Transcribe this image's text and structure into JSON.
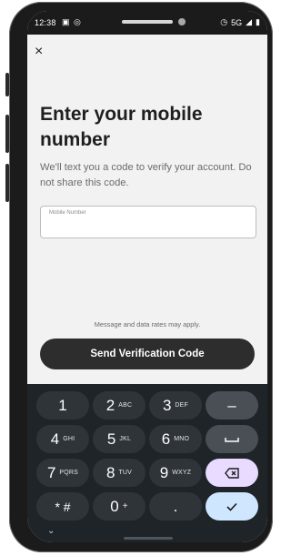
{
  "status_bar": {
    "time": "12:38",
    "network": "5G"
  },
  "page": {
    "title": "Enter your mobile number",
    "subtitle": "We'll text you a code to verify your account. Do not share this code.",
    "input": {
      "label": "Mobile Number",
      "value": ""
    },
    "disclaimer": "Message and data rates may apply.",
    "send_button": "Send Verification Code"
  },
  "keypad": {
    "keys": [
      {
        "num": "1",
        "letters": ""
      },
      {
        "num": "2",
        "letters": "ABC"
      },
      {
        "num": "3",
        "letters": "DEF"
      },
      {
        "num": "4",
        "letters": "GHI"
      },
      {
        "num": "5",
        "letters": "JKL"
      },
      {
        "num": "6",
        "letters": "MNO"
      },
      {
        "num": "7",
        "letters": "PQRS"
      },
      {
        "num": "8",
        "letters": "TUV"
      },
      {
        "num": "9",
        "letters": "WXYZ"
      },
      {
        "num": "* #",
        "letters": ""
      },
      {
        "num": "0",
        "letters": "+"
      },
      {
        "num": ".",
        "letters": ""
      }
    ],
    "functions": {
      "minus": "–"
    }
  },
  "colors": {
    "keypad_bg": "#1f2428",
    "key_bg": "#2f3439",
    "fn_key_bg": "#4a4f55",
    "delete_key_bg": "#e9dbff",
    "confirm_key_bg": "#cfe6ff",
    "button_bg": "#2d2d2d"
  },
  "icons": {
    "close": "close-icon",
    "delete": "backspace-icon",
    "confirm": "check-icon",
    "space": "space-icon",
    "nav": "chevron-down-icon"
  }
}
